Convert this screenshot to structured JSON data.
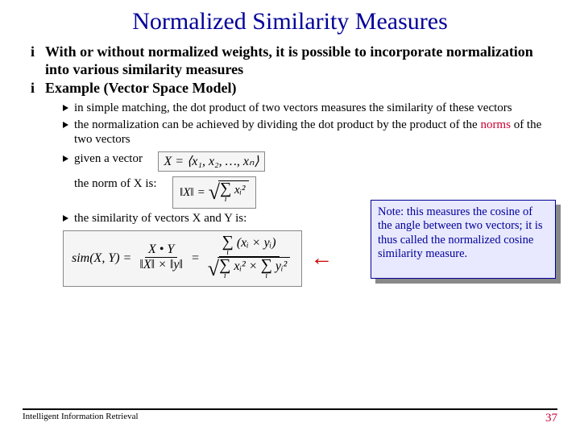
{
  "title": "Normalized Similarity Measures",
  "bullets": {
    "b1": "With or without normalized weights, it is possible to incorporate normalization into various similarity measures",
    "b2": "Example (Vector Space Model)"
  },
  "subs": {
    "s1": "in simple matching, the dot product of two vectors measures the similarity of these vectors",
    "s2_pre": "the normalization can be achieved by dividing the dot product by the product of the ",
    "s2_norms": "norms",
    "s2_post": " of the two vectors",
    "s3": "given a vector",
    "s3_label": "the norm of X is:",
    "s4": "the similarity of vectors X and Y is:"
  },
  "formula": {
    "vec_lhs": "X =",
    "vec_rhs": "⟨x₁, x₂, …, xₙ⟩",
    "norm_lhs": "‖X‖",
    "norm_eq": "=",
    "sum_i": "i",
    "xi2": "xᵢ²",
    "sim_lhs": "sim(X, Y) =",
    "sim_num": "X • Y",
    "sim_den": "‖X‖ × ‖y‖",
    "eq": "=",
    "sum_xy": "(xᵢ × yᵢ)",
    "sum_x2": "xᵢ²",
    "sum_y2": "yᵢ²"
  },
  "note": "Note: this measures the cosine of the angle between two vectors; it is thus called the normalized cosine similarity measure.",
  "footer": {
    "left": "Intelligent Information Retrieval",
    "right": "37"
  }
}
